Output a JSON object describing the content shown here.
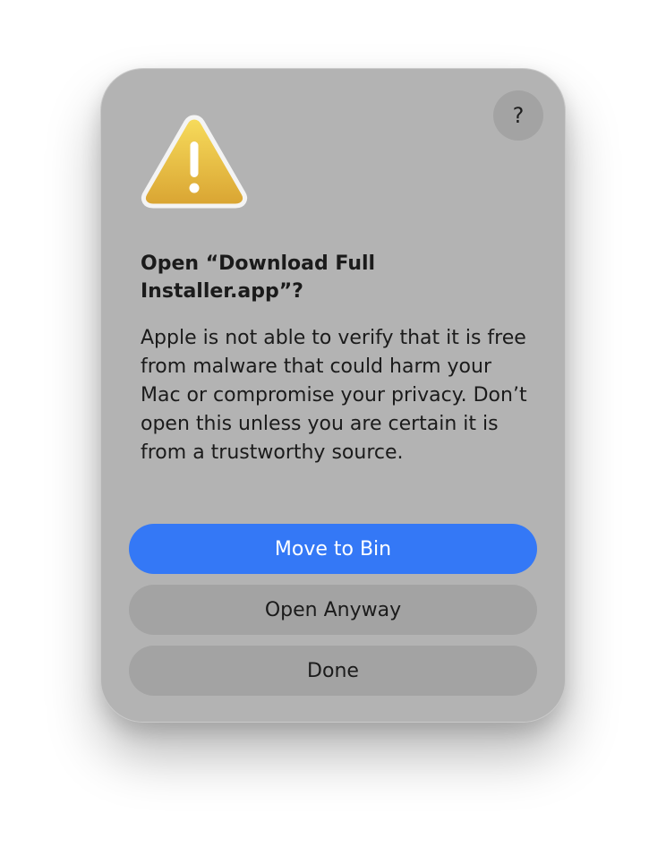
{
  "dialog": {
    "help_label": "?",
    "title": "Open “Download Full Installer.app”?",
    "message": "Apple is not able to verify that it is free from malware that could harm your Mac or compromise your privacy. Don’t open this unless you are certain it is from a trustworthy source.",
    "icon": "warning-triangle-icon",
    "buttons": {
      "move_to_bin": "Move to Bin",
      "open_anyway": "Open Anyway",
      "done": "Done"
    }
  },
  "colors": {
    "dialog_background": "#b3b3b3",
    "primary_button": "#3478f6",
    "secondary_button": "#a3a3a3",
    "warning_yellow": "#e8b83a"
  }
}
